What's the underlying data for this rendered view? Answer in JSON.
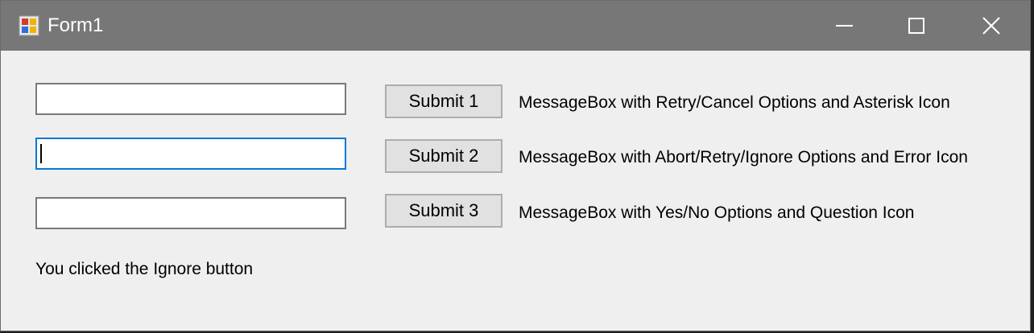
{
  "window": {
    "title": "Form1",
    "icon": "windows-form-icon",
    "controls": {
      "minimize_icon": "minimize-icon",
      "maximize_icon": "maximize-icon",
      "close_icon": "close-icon"
    }
  },
  "rows": [
    {
      "input_value": "",
      "button_label": "Submit 1",
      "description": "MessageBox with Retry/Cancel Options and Asterisk Icon"
    },
    {
      "input_value": "",
      "button_label": "Submit 2",
      "description": "MessageBox with Abort/Retry/Ignore Options and Error Icon"
    },
    {
      "input_value": "",
      "button_label": "Submit 3",
      "description": "MessageBox with Yes/No Options and Question Icon"
    }
  ],
  "status_text": "You clicked the Ignore button",
  "colors": {
    "titlebar": "#777777",
    "window_bg": "#efefef",
    "focus_border": "#0078d7"
  }
}
